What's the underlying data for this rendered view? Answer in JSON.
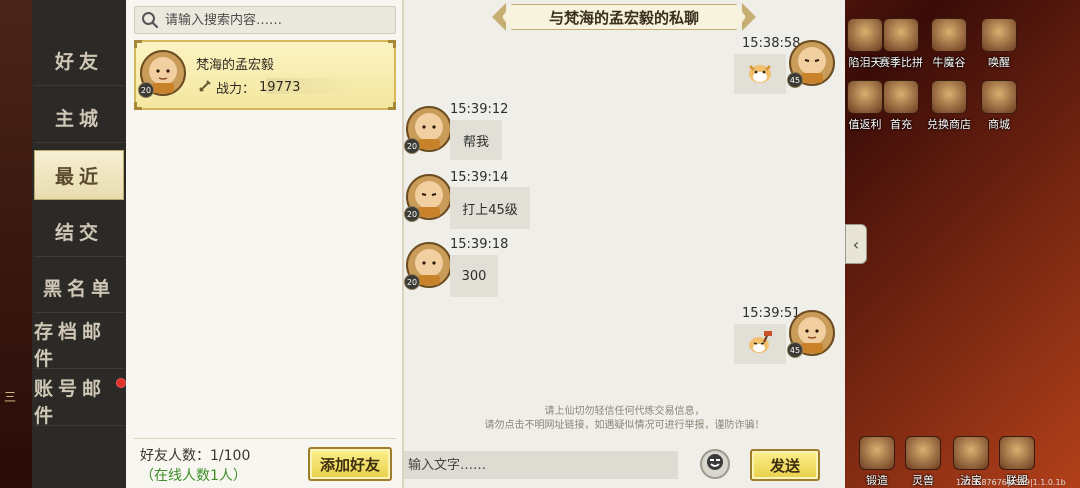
{
  "left_tabs": [
    {
      "label": "好友",
      "active": false
    },
    {
      "label": "主城",
      "active": false
    },
    {
      "label": "最近",
      "active": true
    },
    {
      "label": "结交",
      "active": false
    },
    {
      "label": "黑名单",
      "active": false
    },
    {
      "label": "存档邮件",
      "active": false
    },
    {
      "label": "账号邮件",
      "active": false,
      "badge": true
    }
  ],
  "left_strip_text": "三",
  "search": {
    "placeholder": "请输入搜索内容……"
  },
  "friend_card": {
    "name": "梵海的孟宏毅",
    "level": "20",
    "power_label": "战力：",
    "power_value": "19773"
  },
  "friend_footer": {
    "count": "好友人数：1/100",
    "online": "（在线人数1人）",
    "add_button": "添加好友"
  },
  "chat": {
    "title": "与梵海的孟宏毅的私聊",
    "messages": [
      {
        "time": "15:38:58",
        "side": "right",
        "content": "emoji-dog",
        "level": "45"
      },
      {
        "time": "15:39:12",
        "side": "left",
        "content": "帮我",
        "level": "20"
      },
      {
        "time": "15:39:14",
        "side": "left",
        "content": "打上45级",
        "level": "20"
      },
      {
        "time": "15:39:18",
        "side": "left",
        "content": "300",
        "level": "20"
      },
      {
        "time": "15:39:51",
        "side": "right",
        "content": "emoji-dog-hammer",
        "level": "45"
      }
    ],
    "notice_line1": "请上仙切勿轻信任何代练交易信息，",
    "notice_line2": "请勿点击不明网址链接，如遇疑似情况可进行举报，谨防诈骗！",
    "input_placeholder": "输入文字……",
    "send_button": "发送"
  },
  "game_icons": [
    {
      "label": "陷泪天",
      "icon": "event-icon"
    },
    {
      "label": "赛季比拼",
      "icon": "season-icon"
    },
    {
      "label": "牛魔谷",
      "icon": "valley-icon"
    },
    {
      "label": "唤醒",
      "icon": "awaken-icon"
    },
    {
      "label": "值返利",
      "icon": "rebate-icon"
    },
    {
      "label": "首充",
      "icon": "first-charge-icon"
    },
    {
      "label": "兑换商店",
      "icon": "exchange-shop-icon"
    },
    {
      "label": "商城",
      "icon": "mall-icon"
    },
    {
      "label": "锻造",
      "icon": "forge-icon"
    },
    {
      "label": "灵兽",
      "icon": "spirit-beast-icon"
    },
    {
      "label": "法宝",
      "icon": "magic-treasure-icon"
    },
    {
      "label": "联盟",
      "icon": "alliance-icon"
    }
  ],
  "version": "1370587676|4399|1.1.0.1b",
  "colors": {
    "accent_gold": "#e9cf4a",
    "online_green": "#3f8e2a",
    "badge_red": "#e0312a"
  }
}
